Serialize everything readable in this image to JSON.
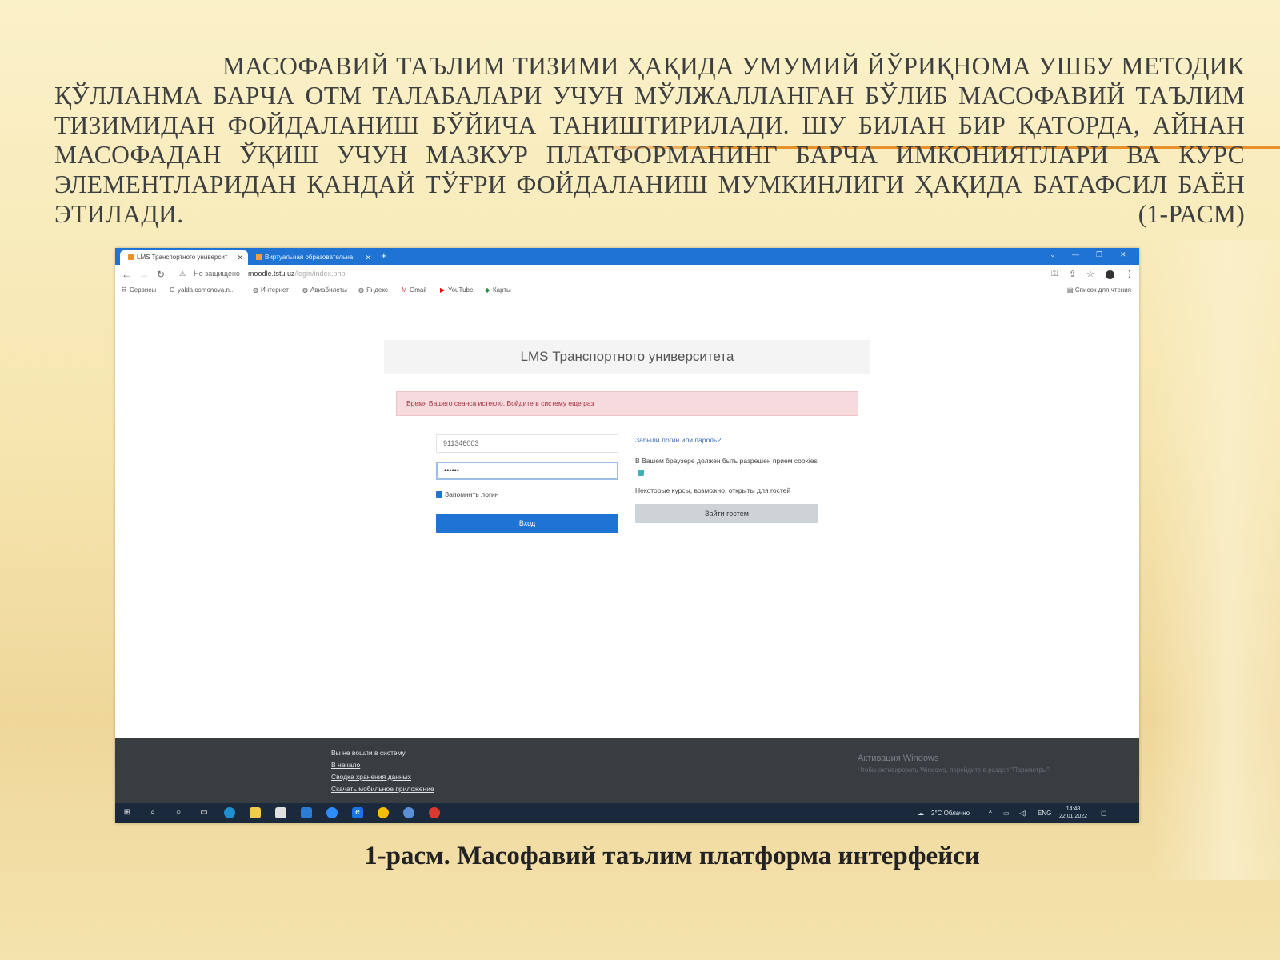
{
  "slide": {
    "body_text": "МАСОФАВИЙ ТАЪЛИМ ТИЗИМИ ҲАҚИДА УМУМИЙ ЙЎРИҚНОМА УШБУ МЕТОДИК ҚЎЛЛАНМА БАРЧА ОТМ ТАЛАБАЛАРИ УЧУН МЎЛЖАЛЛАНГАН БЎЛИБ МАСОФАВИЙ ТАЪЛИМ ТИЗИМИДАН ФОЙДАЛАНИШ БЎЙИЧА ТАНИШТИРИЛАДИ. ШУ БИЛАН БИР ҚАТОРДА, АЙНАН МАСОФАДАН ЎҚИШ УЧУН МАЗКУР ПЛАТФОРМАНИНГ БАРЧА ИМКОНИЯТЛАРИ ВА КУРС ЭЛЕМЕНТЛАРИДАН ҚАНДАЙ ТЎҒРИ ФОЙДАЛАНИШ МУМКИНЛИГИ ҲАҚИДА БАТАФСИЛ БАЁН ЭТИЛАДИ. (1-РАСМ)",
    "caption": "1-расм. Масофавий таълим платформа интерфейси",
    "accent_color": "#e8912a"
  },
  "browser": {
    "tabs": [
      {
        "label": "LMS Транспортного университ",
        "icon": "moodle-icon"
      },
      {
        "label": "Виртуальная образовательна",
        "icon": "page-icon"
      }
    ],
    "new_tab": "+",
    "address": {
      "security_label": "Не защищено",
      "domain": "moodle.tstu.uz",
      "path": "/login/index.php"
    },
    "bookmarks": [
      {
        "label": "Сервисы",
        "icon": "apps-icon"
      },
      {
        "label": "yalda.osmonova.n...",
        "icon": "google-icon"
      },
      {
        "label": "Интернет",
        "icon": "globe-icon"
      },
      {
        "label": "Авиабилеты",
        "icon": "globe-icon"
      },
      {
        "label": "Яндекс",
        "icon": "globe-icon"
      },
      {
        "label": "Gmail",
        "icon": "gmail-icon"
      },
      {
        "label": "YouTube",
        "icon": "youtube-icon"
      },
      {
        "label": "Карты",
        "icon": "maps-icon"
      }
    ],
    "reading_list": "Список для чтения",
    "tab_color": "#1e73d3"
  },
  "page": {
    "site_title": "LMS Транспортного университета",
    "alert": "Время Вашего сеанса истекло. Войдите в систему еще раз",
    "username_value": "911346003",
    "password_value": "••••••",
    "remember_label": "Запомнить логин",
    "login_button": "Вход",
    "forgot_link": "Забыли логин или пароль?",
    "cookies_note": "В Вашем браузере должен быть разрешен прием cookies",
    "guest_note": "Некоторые курсы, возможно, открыты для гостей",
    "guest_button": "Зайти гостем"
  },
  "footer": {
    "not_logged_in": "Вы не вошли в систему",
    "home_link": "В начало",
    "data_retention_link": "Сводка хранения данных",
    "mobile_app_link": "Скачать мобильное приложение",
    "activation_title": "Активация Windows",
    "activation_sub": "Чтобы активировать Windows, перейдите в раздел \"Параметры\"."
  },
  "taskbar": {
    "weather": "2°C Облачно",
    "language": "ENG",
    "time": "14:48",
    "date": "22.01.2022"
  }
}
